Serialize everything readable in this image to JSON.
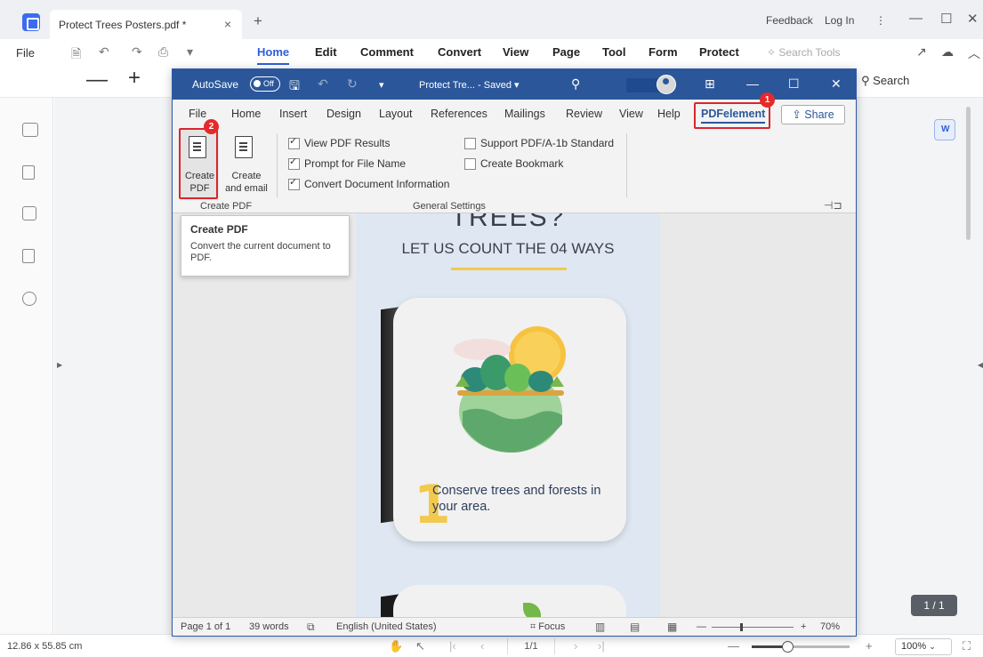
{
  "pe": {
    "tab_title": "Protect Trees Posters.pdf *",
    "tab_close": "×",
    "new_tab": "+",
    "feedback": "Feedback",
    "login": "Log In",
    "more": "⋮",
    "minimize": "—",
    "maximize": "☐",
    "close": "✕",
    "menu": {
      "file": "File",
      "tabs": [
        "Home",
        "Edit",
        "Comment",
        "Convert",
        "View",
        "Page",
        "Tool",
        "Form",
        "Protect"
      ],
      "active_tab": "Home",
      "search_tools": "Search Tools"
    },
    "toolbar": {
      "zoom_out": "—",
      "zoom_in": "+",
      "search": "Search"
    },
    "status": {
      "dimensions": "12.86 x 55.85 cm",
      "page_input": "1/1",
      "zoom_minus": "—",
      "zoom_plus": "+",
      "zoom": "100%",
      "zoom_level": 0.36
    },
    "page_badge": "1 / 1"
  },
  "word": {
    "autosave": "AutoSave",
    "autosave_state": "Off",
    "doc_title": "Protect Tre...  - Saved ▾",
    "ribbon_tabs": [
      "File",
      "Home",
      "Insert",
      "Design",
      "Layout",
      "References",
      "Mailings",
      "Review",
      "View",
      "Help",
      "PDFelement"
    ],
    "active_tab": "PDFelement",
    "share": "Share",
    "create_pdf_label": [
      "Create",
      "PDF"
    ],
    "create_email_label": [
      "Create",
      "and email"
    ],
    "create_group_label": "Create PDF",
    "settings": [
      {
        "label": "View PDF Results",
        "checked": true
      },
      {
        "label": "Prompt for File Name",
        "checked": true
      },
      {
        "label": "Convert Document Information",
        "checked": true
      },
      {
        "label": "Support PDF/A-1b Standard",
        "checked": false
      },
      {
        "label": "Create Bookmark",
        "checked": false
      }
    ],
    "settings_group_label": "General Settings",
    "tooltip": {
      "title": "Create PDF",
      "body": "Convert the current document to PDF."
    },
    "callouts": [
      "1",
      "2"
    ],
    "page": {
      "heading": "TREES?",
      "subheading": "LET US COUNT THE 04 WAYS",
      "number": "1",
      "item_text": "Conserve trees and forests in your area."
    },
    "status": {
      "page": "Page 1 of 1",
      "words": "39 words",
      "language": "English (United States)",
      "focus": "Focus",
      "zoom_minus": "—",
      "zoom_plus": "+",
      "zoom": "70%",
      "zoom_level": 0.7
    }
  },
  "colors": {
    "pe_accent": "#2f5fd8",
    "word_title": "#2b579a",
    "callout": "#d9262e"
  }
}
